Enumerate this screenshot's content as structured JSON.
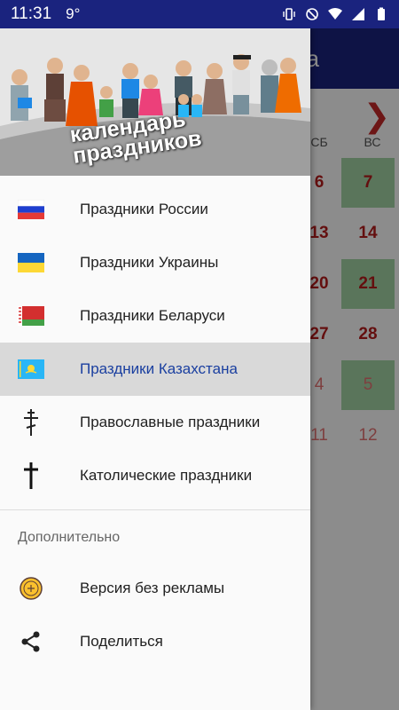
{
  "status_bar": {
    "time": "11:31",
    "temperature": "9°"
  },
  "background_app": {
    "title_fragment": "а",
    "weekdays": [
      "СБ",
      "ВС"
    ],
    "rows": [
      [
        "6",
        "7"
      ],
      [
        "13",
        "14"
      ],
      [
        "20",
        "21"
      ],
      [
        "27",
        "28"
      ],
      [
        "4",
        "5"
      ],
      [
        "11",
        "12"
      ]
    ],
    "next_arrow": "❯"
  },
  "drawer": {
    "header": {
      "title_line1": "календарь",
      "title_line2": "праздников"
    },
    "items": [
      {
        "label": "Праздники России",
        "icon": "russia-flag-icon"
      },
      {
        "label": "Праздники Украины",
        "icon": "ukraine-flag-icon"
      },
      {
        "label": "Праздники Беларуси",
        "icon": "belarus-flag-icon"
      },
      {
        "label": "Праздники Казахстана",
        "icon": "kazakhstan-flag-icon",
        "active": true
      },
      {
        "label": "Православные праздники",
        "icon": "orthodox-cross-icon"
      },
      {
        "label": "Католические праздники",
        "icon": "latin-cross-icon"
      }
    ],
    "section_title": "Дополнительно",
    "extra_items": [
      {
        "label": "Версия без рекламы",
        "icon": "no-ads-coin-icon"
      },
      {
        "label": "Поделиться",
        "icon": "share-icon"
      }
    ]
  },
  "colors": {
    "appbar": "#1a237e",
    "active_text": "#1a3fa0",
    "active_bg": "#d9d9d9",
    "calendar_green": "#a5d6a7",
    "calendar_red": "#b71c1c"
  }
}
